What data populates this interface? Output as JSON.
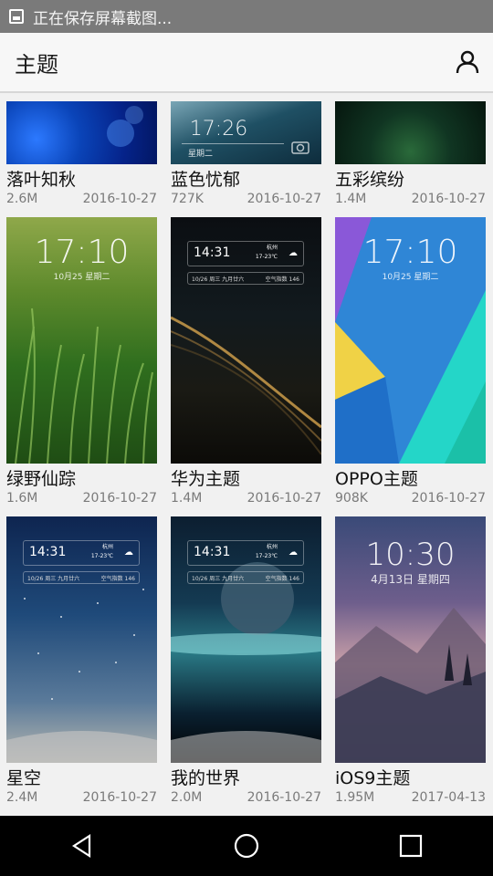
{
  "status_bar": {
    "text": "正在保存屏幕截图..."
  },
  "header": {
    "title": "主题"
  },
  "themes": [
    {
      "name": "落叶知秋",
      "size": "2.6M",
      "date": "2016-10-27"
    },
    {
      "name": "蓝色忧郁",
      "size": "727K",
      "date": "2016-10-27",
      "clock": "17:26",
      "date_text": "星期二"
    },
    {
      "name": "五彩缤纷",
      "size": "1.4M",
      "date": "2016-10-27"
    },
    {
      "name": "绿野仙踪",
      "size": "1.6M",
      "date": "2016-10-27",
      "clock": "17:10",
      "date_text": "10月25    星期二"
    },
    {
      "name": "华为主题",
      "size": "1.4M",
      "date": "2016-10-27",
      "widget_time": "14:31",
      "widget_city": "杭州",
      "widget_temp": "17-23℃",
      "widget_date": "10/26 周三 九月廿六",
      "widget_air": "空气指数 146"
    },
    {
      "name": "OPPO主题",
      "size": "908K",
      "date": "2016-10-27",
      "clock": "17:10",
      "date_text": "10月25    星期二"
    },
    {
      "name": "星空",
      "size": "2.4M",
      "date": "2016-10-27",
      "widget_time": "14:31",
      "widget_city": "杭州",
      "widget_temp": "17-23℃",
      "widget_date": "10/26 周三 九月廿六",
      "widget_air": "空气指数 146"
    },
    {
      "name": "我的世界",
      "size": "2.0M",
      "date": "2016-10-27",
      "widget_time": "14:31",
      "widget_city": "杭州",
      "widget_temp": "17-23℃",
      "widget_date": "10/26 周三 九月廿六",
      "widget_air": "空气指数 146"
    },
    {
      "name": "iOS9主题",
      "size": "1.95M",
      "date": "2017-04-13",
      "clock": "10:30",
      "date_text": "4月13日 星期四"
    }
  ],
  "icons": {
    "status": "screenshot-icon",
    "profile": "person-icon",
    "nav": [
      "back-icon",
      "home-icon",
      "recents-icon"
    ]
  },
  "colors": {
    "status_bar": "#7a7a7a",
    "header_bg": "#f7f7f7",
    "nav_bar": "#000000"
  }
}
